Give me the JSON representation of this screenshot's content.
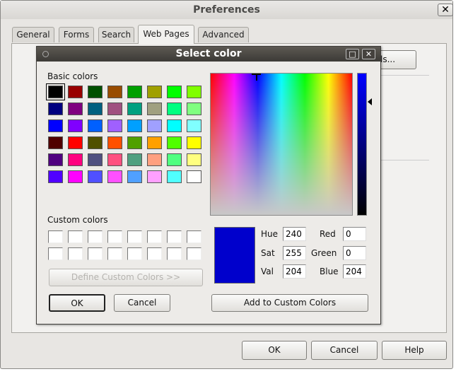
{
  "prefs": {
    "title": "Preferences",
    "close_glyph": "✕",
    "tabs": [
      {
        "label": "General"
      },
      {
        "label": "Forms"
      },
      {
        "label": "Search"
      },
      {
        "label": "Web Pages"
      },
      {
        "label": "Advanced"
      }
    ],
    "partial_button_label": "ls...",
    "buttons": {
      "ok": "OK",
      "cancel": "Cancel",
      "help": "Help"
    }
  },
  "dialog": {
    "title": "Select color",
    "maximize_glyph": "□",
    "close_glyph": "✕",
    "basic_colors_label": "Basic colors",
    "custom_colors_label": "Custom colors",
    "define_button_label": "Define Custom Colors >>",
    "ok_label": "OK",
    "cancel_label": "Cancel",
    "add_button_label": "Add to Custom Colors",
    "current_color": "#0000cc",
    "fields": {
      "hue_label": "Hue",
      "hue": "240",
      "sat_label": "Sat",
      "sat": "255",
      "val_label": "Val",
      "val": "204",
      "red_label": "Red",
      "red": "0",
      "green_label": "Green",
      "green": "0",
      "blue_label": "Blue",
      "blue": "204"
    },
    "basic_colors": [
      [
        "#000000",
        "#990000",
        "#005000",
        "#994c00",
        "#00a000",
        "#a0a000",
        "#00ff00",
        "#80ff00"
      ],
      [
        "#000080",
        "#800080",
        "#006080",
        "#a05080",
        "#00a080",
        "#a0a080",
        "#00ff80",
        "#80ff80"
      ],
      [
        "#0000ff",
        "#8000ff",
        "#0060ff",
        "#a060ff",
        "#00a0ff",
        "#a0a0ff",
        "#00ffff",
        "#80ffff"
      ],
      [
        "#500000",
        "#ff0000",
        "#505000",
        "#ff5000",
        "#50a000",
        "#ffa000",
        "#50ff00",
        "#ffff00"
      ],
      [
        "#500080",
        "#ff0080",
        "#505080",
        "#ff5080",
        "#50a080",
        "#ffa080",
        "#50ff80",
        "#ffff80"
      ],
      [
        "#5000ff",
        "#ff00ff",
        "#5050ff",
        "#ff50ff",
        "#50a0ff",
        "#ffa0ff",
        "#50ffff",
        "#ffffff"
      ]
    ],
    "custom_colors_count": 16
  }
}
